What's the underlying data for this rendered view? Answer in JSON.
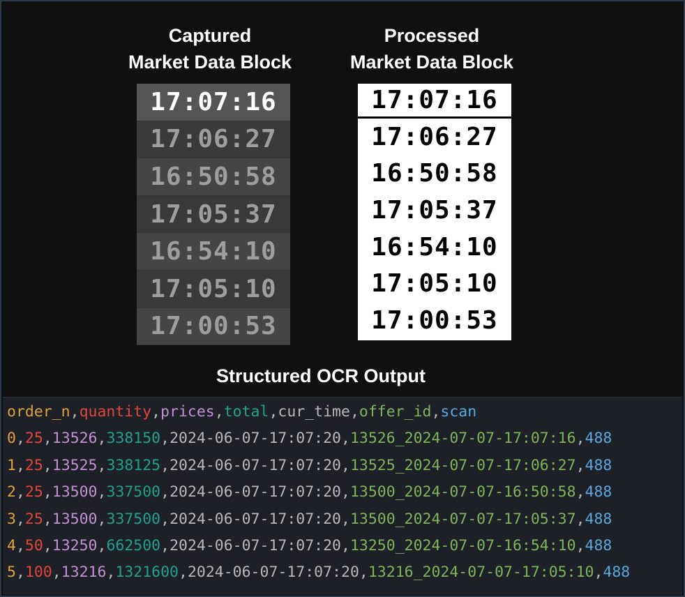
{
  "headings": {
    "captured": [
      "Captured",
      "Market Data Block"
    ],
    "processed": [
      "Processed",
      "Market Data Block"
    ],
    "ocr": "Structured OCR Output"
  },
  "captured_times": [
    "17:07:16",
    "17:06:27",
    "16:50:58",
    "17:05:37",
    "16:54:10",
    "17:05:10",
    "17:00:53"
  ],
  "processed_times": [
    "17:07:16",
    "17:06:27",
    "16:50:58",
    "17:05:37",
    "16:54:10",
    "17:05:10",
    "17:00:53"
  ],
  "csv": {
    "header": [
      "order_n",
      "quantity",
      "prices",
      "total",
      "cur_time",
      "offer_id",
      "scan"
    ],
    "rows": [
      [
        "0",
        "25",
        "13526",
        "338150",
        "2024-06-07-17:07:20",
        "13526_2024-07-07-17:07:16",
        "488"
      ],
      [
        "1",
        "25",
        "13525",
        "338125",
        "2024-06-07-17:07:20",
        "13525_2024-07-07-17:06:27",
        "488"
      ],
      [
        "2",
        "25",
        "13500",
        "337500",
        "2024-06-07-17:07:20",
        "13500_2024-07-07-16:50:58",
        "488"
      ],
      [
        "3",
        "25",
        "13500",
        "337500",
        "2024-06-07-17:07:20",
        "13500_2024-07-07-17:05:37",
        "488"
      ],
      [
        "4",
        "50",
        "13250",
        "662500",
        "2024-06-07-17:07:20",
        "13250_2024-07-07-16:54:10",
        "488"
      ],
      [
        "5",
        "100",
        "13216",
        "1321600",
        "2024-06-07-17:07:20",
        "13216_2024-07-07-17:05:10",
        "488"
      ]
    ],
    "column_colors": [
      "#e0a23a",
      "#e0473a",
      "#c390d6",
      "#1fa08d",
      "#b8b8b8",
      "#7fb55a",
      "#5aa8e0"
    ]
  }
}
